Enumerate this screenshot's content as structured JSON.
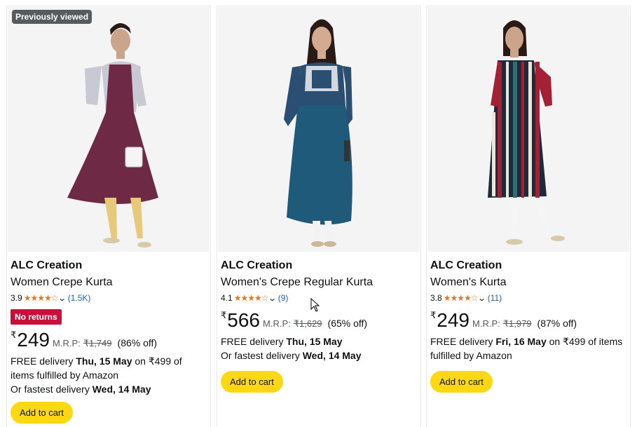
{
  "products": [
    {
      "badge": "Previously viewed",
      "brand": "ALC Creation",
      "title": "Women Crepe Kurta",
      "rating": "3.9",
      "stars": 3.9,
      "review_count": "(1.5K)",
      "tag": "No returns",
      "currency": "₹",
      "price": "249",
      "mrp_label": "M.R.P:",
      "mrp": "₹1,749",
      "discount": "(86% off)",
      "delivery_prefix": "FREE delivery ",
      "delivery_date": "Thu, 15 May",
      "delivery_suffix": " on ₹499 of items fulfilled by Amazon",
      "fastest_prefix": "Or fastest delivery ",
      "fastest_date": "Wed, 14 May",
      "cart_label": "Add to cart",
      "colors": {
        "dress": "#6e2a45",
        "jacket": "#c9c9d4",
        "legs": "#e6c97a"
      }
    },
    {
      "brand": "ALC Creation",
      "title": "Women's Crepe Regular Kurta",
      "rating": "4.1",
      "stars": 4.1,
      "review_count": "(9)",
      "currency": "₹",
      "price": "566",
      "mrp_label": "M.R.P:",
      "mrp": "₹1,629",
      "discount": "(65% off)",
      "delivery_prefix": "FREE delivery ",
      "delivery_date": "Thu, 15 May",
      "delivery_suffix": "",
      "fastest_prefix": "Or fastest delivery ",
      "fastest_date": "Wed, 14 May",
      "cart_label": "Add to cart",
      "colors": {
        "dress": "#1f5a7a",
        "yoke": "#2b4f73",
        "legs": "#f2f2f2"
      }
    },
    {
      "brand": "ALC Creation",
      "title": "Women's Kurta",
      "rating": "3.8",
      "stars": 3.8,
      "review_count": "(11)",
      "currency": "₹",
      "price": "249",
      "mrp_label": "M.R.P:",
      "mrp": "₹1,979",
      "discount": "(87% off)",
      "delivery_prefix": "FREE delivery ",
      "delivery_date": "Fri, 16 May",
      "delivery_suffix": " on ₹499 of items fulfilled by Amazon",
      "cart_label": "Add to cart",
      "colors": {
        "dress": "#1e2a3a",
        "stripe1": "#a32035",
        "stripe2": "#e9e6dc",
        "stripe3": "#2f6f73",
        "legs": "#f5f5f5"
      }
    }
  ],
  "icons": {
    "star": "star-icon",
    "chevron": "chevron-down-icon",
    "cursor": "mouse-cursor-icon"
  }
}
